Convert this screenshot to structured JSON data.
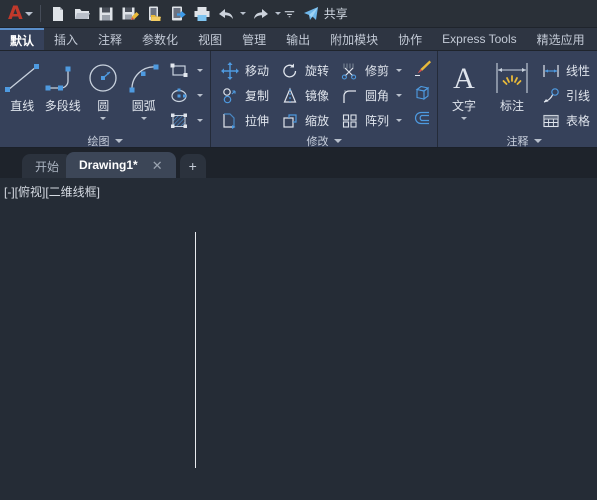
{
  "app": {
    "logo": "A",
    "share_label": "共享",
    "share_icon": "paper-plane-icon"
  },
  "quick_access": {
    "buttons": [
      {
        "name": "new-file-icon",
        "tooltip": "新建"
      },
      {
        "name": "open-folder-icon",
        "tooltip": "打开"
      },
      {
        "name": "save-icon",
        "tooltip": "保存"
      },
      {
        "name": "save-as-icon",
        "tooltip": "另存为"
      },
      {
        "name": "export-icon",
        "tooltip": "输出"
      },
      {
        "name": "publish-icon",
        "tooltip": "发布"
      },
      {
        "name": "print-icon",
        "tooltip": "打印"
      },
      {
        "name": "undo-icon",
        "tooltip": "放弃"
      },
      {
        "name": "redo-icon",
        "tooltip": "重做"
      },
      {
        "name": "customize-icon",
        "tooltip": "自定义快速访问工具栏"
      }
    ]
  },
  "ribbon": {
    "tabs": [
      {
        "label": "默认",
        "active": true
      },
      {
        "label": "插入",
        "active": false
      },
      {
        "label": "注释",
        "active": false
      },
      {
        "label": "参数化",
        "active": false
      },
      {
        "label": "视图",
        "active": false
      },
      {
        "label": "管理",
        "active": false
      },
      {
        "label": "输出",
        "active": false
      },
      {
        "label": "附加模块",
        "active": false
      },
      {
        "label": "协作",
        "active": false
      },
      {
        "label": "Express Tools",
        "active": false
      },
      {
        "label": "精选应用",
        "active": false
      }
    ],
    "panels": [
      {
        "title": "绘图",
        "big_buttons": [
          {
            "label": "直线",
            "icon": "line-icon",
            "has_caret": false
          },
          {
            "label": "多段线",
            "icon": "polyline-icon",
            "has_caret": false
          },
          {
            "label": "圆",
            "icon": "circle-icon",
            "has_caret": true
          },
          {
            "label": "圆弧",
            "icon": "arc-icon",
            "has_caret": true
          }
        ],
        "small_buttons": [
          {
            "label": "",
            "icon": "rectangle-icon",
            "has_caret": true
          },
          {
            "label": "",
            "icon": "ellipse-icon",
            "has_caret": true
          },
          {
            "label": "",
            "icon": "hatch-icon",
            "has_caret": true
          }
        ]
      },
      {
        "title": "修改",
        "small_buttons": [
          {
            "label": "移动",
            "icon": "move-icon",
            "has_caret": false
          },
          {
            "label": "复制",
            "icon": "copy-icon",
            "has_caret": false
          },
          {
            "label": "拉伸",
            "icon": "stretch-icon",
            "has_caret": false
          },
          {
            "label": "旋转",
            "icon": "rotate-icon",
            "has_caret": false
          },
          {
            "label": "镜像",
            "icon": "mirror-icon",
            "has_caret": false
          },
          {
            "label": "缩放",
            "icon": "scale-icon",
            "has_caret": false
          },
          {
            "label": "修剪",
            "icon": "trim-icon",
            "has_caret": true
          },
          {
            "label": "圆角",
            "icon": "fillet-icon",
            "has_caret": true
          },
          {
            "label": "阵列",
            "icon": "array-icon",
            "has_caret": true
          }
        ],
        "icon_buttons": [
          {
            "icon": "match-properties-icon"
          },
          {
            "icon": "explode-icon"
          },
          {
            "icon": "offset-icon"
          }
        ]
      },
      {
        "title": "注释",
        "big_buttons": [
          {
            "label": "文字",
            "icon": "text-icon",
            "has_caret": true
          },
          {
            "label": "标注",
            "icon": "dimension-icon",
            "has_caret": false
          }
        ],
        "small_buttons": [
          {
            "label": "线性",
            "icon": "linear-dimension-icon",
            "has_caret": true
          },
          {
            "label": "引线",
            "icon": "leader-icon",
            "has_caret": true
          },
          {
            "label": "表格",
            "icon": "table-icon",
            "has_caret": false
          }
        ]
      }
    ]
  },
  "document_tabs": {
    "tabs": [
      {
        "label": "开始",
        "active": false,
        "closable": false
      },
      {
        "label": "Drawing1*",
        "active": true,
        "closable": true
      }
    ],
    "close_glyph": "✕",
    "new_tab_glyph": "+"
  },
  "canvas": {
    "viewport_label": "[-][俯视][二维线框]",
    "objects": [
      {
        "type": "line",
        "name": "drawn-line",
        "color": "#e8eaee"
      }
    ]
  },
  "colors": {
    "canvas_bg": "#252c36",
    "ribbon_bg": "#36415a",
    "titlebar_bg": "#2a3038",
    "tabstrip_bg": "#2e3542",
    "accent_blue": "#5a8ec9",
    "logo_red": "#c0392b",
    "icon_blue": "#4e9ae0",
    "text": "#dfe4ec"
  }
}
